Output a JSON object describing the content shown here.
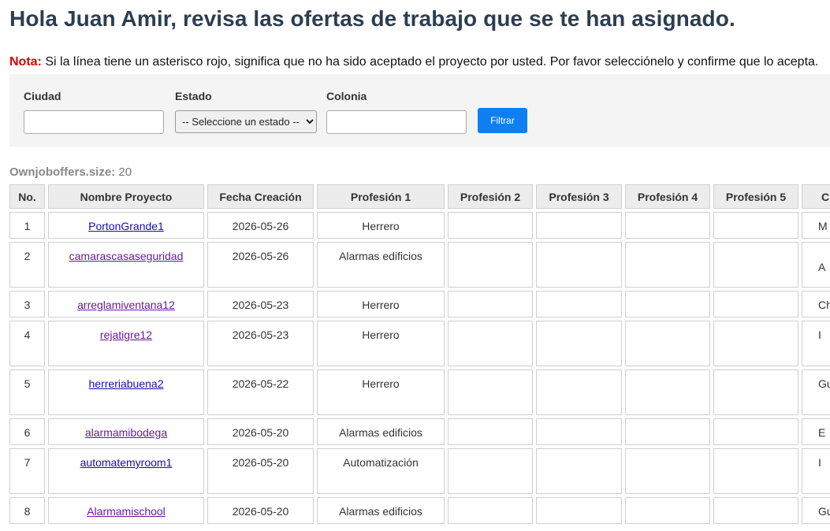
{
  "header": {
    "title": "Hola Juan Amir, revisa las ofertas de trabajo que se te han asignado.",
    "note_label": "Nota:",
    "note_text": " Si la línea tiene un asterisco rojo, significa que no ha sido aceptado el proyecto por usted. Por favor selecciónelo y confirme que lo acepta."
  },
  "filters": {
    "city_label": "Ciudad",
    "city_value": "",
    "state_label": "Estado",
    "state_selected": "-- Seleccione un estado --",
    "colonia_label": "Colonia",
    "colonia_value": "",
    "submit_label": "Filtrar"
  },
  "size": {
    "label": "Ownjoboffers.size:",
    "value": "20"
  },
  "table": {
    "headers": [
      "No.",
      "Nombre Proyecto",
      "Fecha Creación",
      "Profesión 1",
      "Profesión 2",
      "Profesión 3",
      "Profesión 4",
      "Profesión 5",
      "C"
    ],
    "rows": [
      {
        "no": "1",
        "name": "PortonGrande1",
        "date": "2026-05-26",
        "p1": "Herrero",
        "p2": "",
        "p3": "",
        "p4": "",
        "p5": "",
        "city": "M"
      },
      {
        "no": "2",
        "name": "camarascasaseguridad",
        "date": "2026-05-26",
        "p1": "Alarmas edificios",
        "p2": "",
        "p3": "",
        "p4": "",
        "p5": "",
        "city": "A"
      },
      {
        "no": "3",
        "name": "arreglamiventana12",
        "date": "2026-05-23",
        "p1": "Herrero",
        "p2": "",
        "p3": "",
        "p4": "",
        "p5": "",
        "city": "Ch"
      },
      {
        "no": "4",
        "name": "rejatigre12",
        "date": "2026-05-23",
        "p1": "Herrero",
        "p2": "",
        "p3": "",
        "p4": "",
        "p5": "",
        "city": "I"
      },
      {
        "no": "5",
        "name": "herreriabuena2",
        "date": "2026-05-22",
        "p1": "Herrero",
        "p2": "",
        "p3": "",
        "p4": "",
        "p5": "",
        "city": "Gu"
      },
      {
        "no": "6",
        "name": "alarmamibodega",
        "date": "2026-05-20",
        "p1": "Alarmas edificios",
        "p2": "",
        "p3": "",
        "p4": "",
        "p5": "",
        "city": "E"
      },
      {
        "no": "7",
        "name": "automatemyroom1",
        "date": "2026-05-20",
        "p1": "Automatización",
        "p2": "",
        "p3": "",
        "p4": "",
        "p5": "",
        "city": "I"
      },
      {
        "no": "8",
        "name": "Alarmamischool",
        "date": "2026-05-20",
        "p1": "Alarmas edificios",
        "p2": "",
        "p3": "",
        "p4": "",
        "p5": "",
        "city": "Gu"
      }
    ]
  }
}
